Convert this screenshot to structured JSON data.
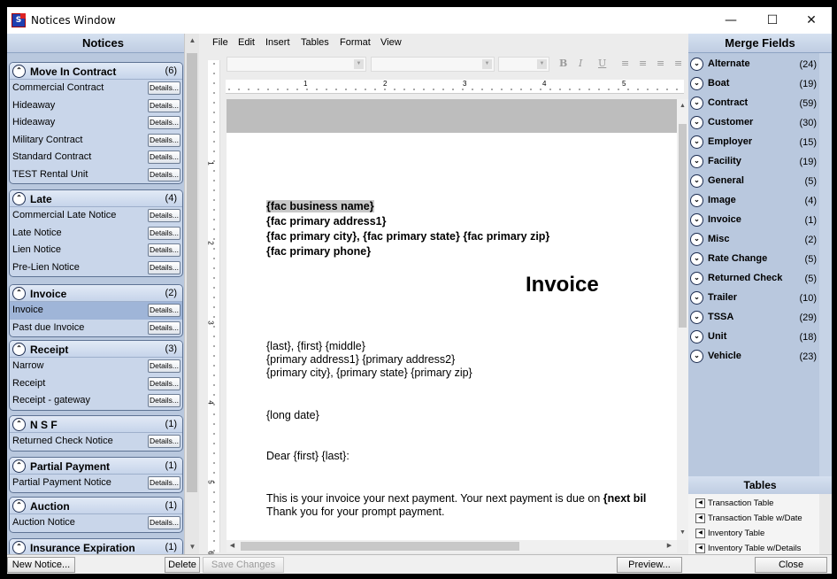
{
  "window": {
    "title": "Notices Window",
    "icon": "app-logo-icon"
  },
  "window_controls": {
    "minimize": "—",
    "maximize": "☐",
    "close": "✕"
  },
  "notices": {
    "header": "Notices",
    "groups": [
      {
        "name": "Move In Contract",
        "count": "(6)",
        "items": [
          "Commercial Contract",
          "Hideaway",
          "Hideaway",
          "Military Contract",
          "Standard Contract",
          "TEST Rental Unit"
        ]
      },
      {
        "name": "Late",
        "count": "(4)",
        "items": [
          "Commercial Late Notice",
          "Late Notice",
          "Lien Notice",
          "Pre-Lien Notice"
        ]
      },
      {
        "name": "Invoice",
        "count": "(2)",
        "items": [
          "Invoice",
          "Past due Invoice"
        ],
        "selected_index": 0
      },
      {
        "name": "Receipt",
        "count": "(3)",
        "items": [
          "Narrow",
          "Receipt",
          "Receipt - gateway"
        ]
      },
      {
        "name": "N S F",
        "count": "(1)",
        "items": [
          "Returned Check Notice"
        ]
      },
      {
        "name": "Partial Payment",
        "count": "(1)",
        "items": [
          "Partial Payment Notice"
        ]
      },
      {
        "name": "Auction",
        "count": "(1)",
        "items": [
          "Auction Notice"
        ]
      },
      {
        "name": "Insurance Expiration",
        "count": "(1)",
        "items": []
      }
    ],
    "details_label": "Details..."
  },
  "menu": [
    "File",
    "Edit",
    "Insert",
    "Tables",
    "Format",
    "View"
  ],
  "toolbar": {
    "bold": "B",
    "italic": "I",
    "underline": "U"
  },
  "ruler_marks": [
    "1",
    "2",
    "3",
    "4",
    "5"
  ],
  "ruler_v_marks": [
    "1",
    "2",
    "3",
    "4",
    "5",
    "6"
  ],
  "document": {
    "fac_business_name": "{fac business name}",
    "fac_address1": "{fac primary address1}",
    "fac_city_line": "{fac primary city}, {fac primary state}  {fac primary zip}",
    "fac_phone": "{fac primary phone}",
    "heading": "Invoice",
    "name_line": "{last}, {first} {middle}",
    "address_line": "{primary address1} {primary address2}",
    "city_line": "{primary city}, {primary state} {primary zip}",
    "date_line": "{long date}",
    "salutation": "Dear {first} {last}:",
    "body_line1_prefix": "This is your invoice your next payment. Your next payment is due on ",
    "body_line1_bold": "{next bil",
    "body_line2": "Thank you for your prompt payment."
  },
  "merge_fields": {
    "header": "Merge Fields",
    "items": [
      {
        "name": "Alternate",
        "count": "(24)"
      },
      {
        "name": "Boat",
        "count": "(19)"
      },
      {
        "name": "Contract",
        "count": "(59)"
      },
      {
        "name": "Customer",
        "count": "(30)"
      },
      {
        "name": "Employer",
        "count": "(15)"
      },
      {
        "name": "Facility",
        "count": "(19)"
      },
      {
        "name": "General",
        "count": "(5)"
      },
      {
        "name": "Image",
        "count": "(4)"
      },
      {
        "name": "Invoice",
        "count": "(1)"
      },
      {
        "name": "Misc",
        "count": "(2)"
      },
      {
        "name": "Rate Change",
        "count": "(5)"
      },
      {
        "name": "Returned Check",
        "count": "(5)"
      },
      {
        "name": "Trailer",
        "count": "(10)"
      },
      {
        "name": "TSSA",
        "count": "(29)"
      },
      {
        "name": "Unit",
        "count": "(18)"
      },
      {
        "name": "Vehicle",
        "count": "(23)"
      }
    ]
  },
  "tables": {
    "header": "Tables",
    "items": [
      "Transaction Table",
      "Transaction Table w/Date",
      "Inventory Table",
      "Inventory Table w/Details"
    ]
  },
  "bottom": {
    "new_notice": "New Notice...",
    "delete": "Delete",
    "save_changes": "Save Changes",
    "preview": "Preview...",
    "close": "Close"
  }
}
